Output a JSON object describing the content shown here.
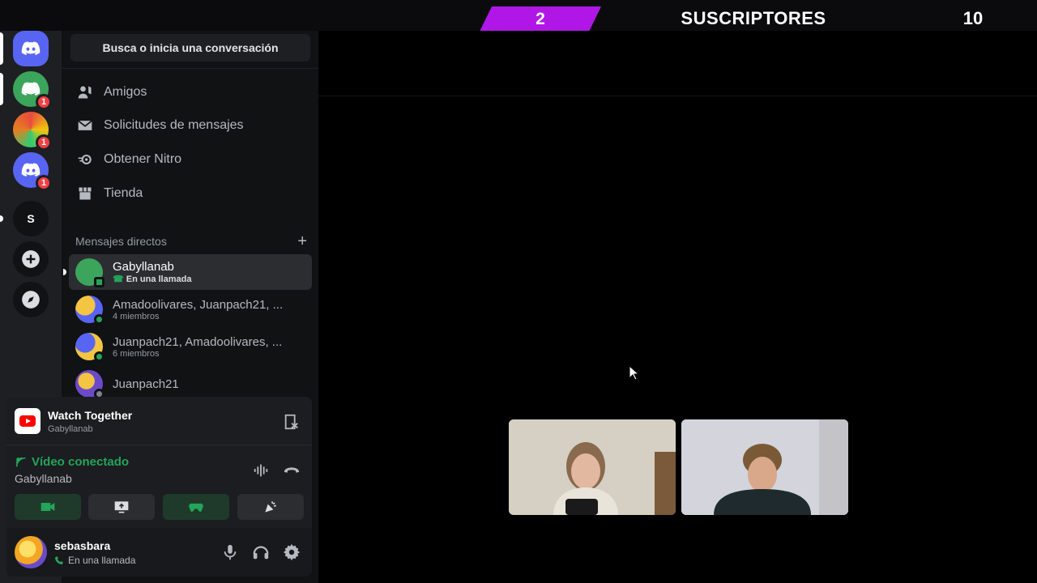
{
  "overlay": {
    "subscriber_count": "2",
    "label": "SUSCRIPTORES",
    "goal": "10"
  },
  "guilds": [
    {
      "name": "home",
      "icon": "discord-logo-icon"
    },
    {
      "name": "server-1",
      "badge": "1"
    },
    {
      "name": "server-2",
      "badge": "1"
    },
    {
      "name": "server-3",
      "badge": "1"
    },
    {
      "name": "server-s",
      "letter": "S"
    },
    {
      "name": "add-server",
      "icon": "plus-icon"
    },
    {
      "name": "discover",
      "icon": "compass-icon"
    }
  ],
  "sidebar": {
    "search_placeholder": "Busca o inicia una conversación",
    "nav": [
      {
        "label": "Amigos",
        "icon": "friends-icon"
      },
      {
        "label": "Solicitudes de mensajes",
        "icon": "mail-icon"
      },
      {
        "label": "Obtener Nitro",
        "icon": "nitro-icon"
      },
      {
        "label": "Tienda",
        "icon": "shop-icon"
      }
    ],
    "dm_header": "Mensajes directos",
    "dms": [
      {
        "name": "Gabyllanab",
        "sub": "En una llamada",
        "active": true
      },
      {
        "name": "Amadoolivares, Juanpach21, ...",
        "sub": "4 miembros"
      },
      {
        "name": "Juanpach21, Amadoolivares, ...",
        "sub": "6 miembros"
      },
      {
        "name": "Juanpach21",
        "sub": ""
      }
    ]
  },
  "panel": {
    "activity_title": "Watch Together",
    "activity_sub": "Gabyllanab",
    "voice_status": "Vídeo conectado",
    "voice_channel": "Gabyllanab",
    "user_name": "sebasbara",
    "user_status": "En una llamada"
  },
  "colors": {
    "accent_purple": "#b017e6",
    "discord_blurple": "#5865f2",
    "green": "#23a55a",
    "badge_red": "#f23f43"
  }
}
